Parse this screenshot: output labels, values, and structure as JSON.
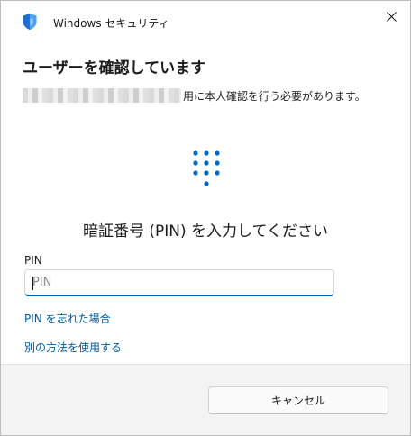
{
  "window": {
    "title": "Windows セキュリティ",
    "close_icon": "close-icon",
    "app_icon": "shield-icon"
  },
  "dialog": {
    "heading": "ユーザーを確認しています",
    "account_suffix": "用に本人確認を行う必要があります。",
    "center_icon": "keypad-icon",
    "pin_prompt": "暗証番号 (PIN) を入力してください",
    "pin_label": "PIN",
    "pin_placeholder": "PIN",
    "pin_value": "",
    "forgot_pin_link": "PIN を忘れた場合",
    "other_method_link": "別の方法を使用する"
  },
  "footer": {
    "cancel_label": "キャンセル"
  },
  "colors": {
    "accent": "#005fb8",
    "link": "#005a9e",
    "keypad": "#0067c0"
  }
}
